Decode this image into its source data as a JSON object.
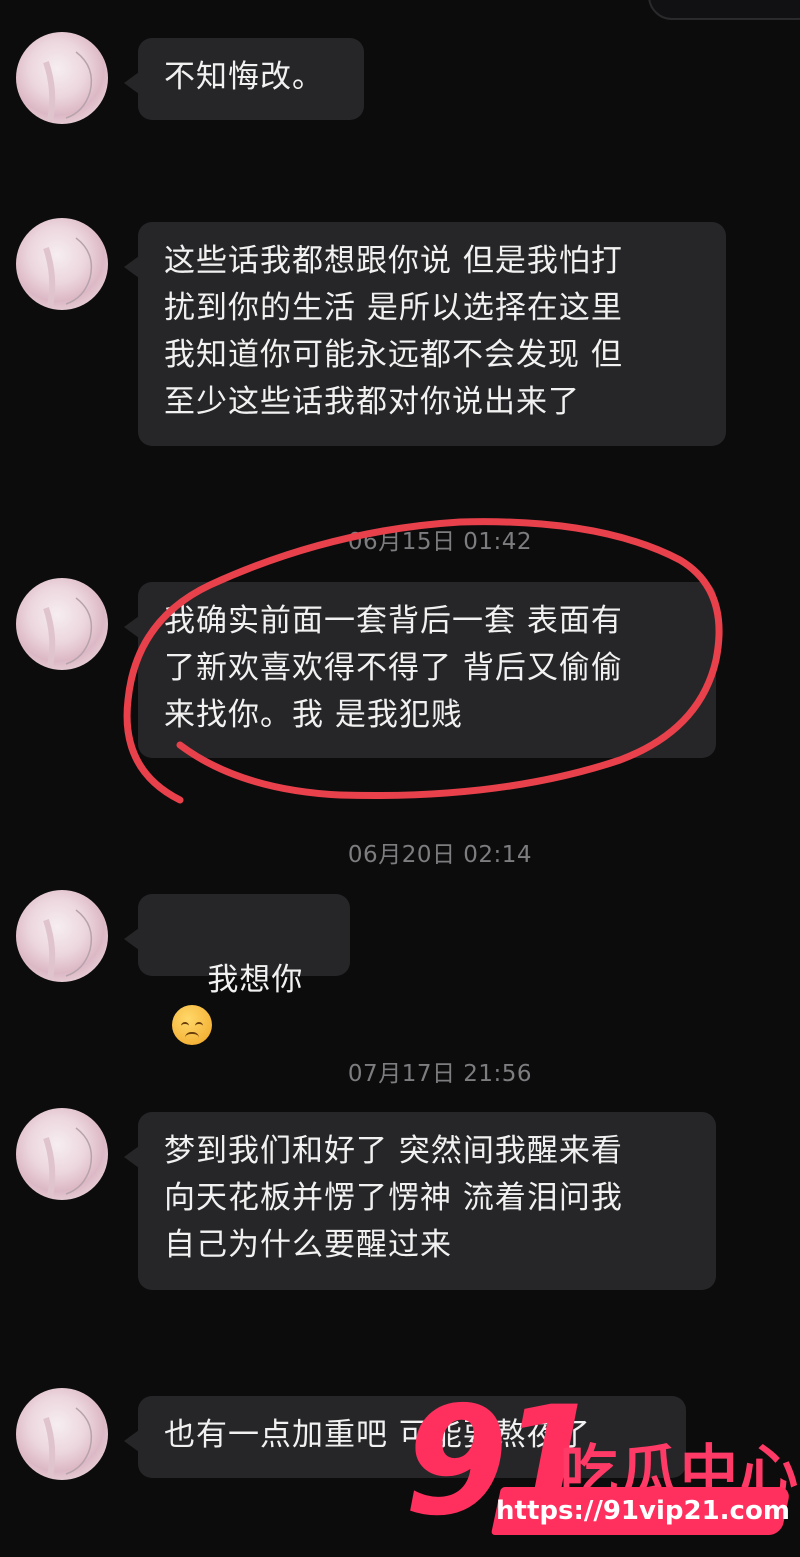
{
  "messages": [
    {
      "text": "不知悔改。"
    },
    {
      "text": "这些话我都想跟你说 但是我怕打\n扰到你的生活 是所以选择在这里\n我知道你可能永远都不会发现 但\n至少这些话我都对你说出来了"
    },
    {
      "text": "我确实前面一套背后一套 表面有\n了新欢喜欢得不得了 背后又偷偷\n来找你。我 是我犯贱"
    },
    {
      "text": "我想你",
      "emoji": "pensive-face"
    },
    {
      "text": "梦到我们和好了 突然间我醒来看\n向天花板并愣了愣神 流着泪问我\n自己为什么要醒过来"
    },
    {
      "text": "也有一点加重吧 可能要熬夜了"
    }
  ],
  "timestamps": [
    "06月15日 01:42",
    "06月20日 02:14",
    "07月17日 21:56"
  ],
  "annotation": {
    "color": "#e8414b",
    "shape": "hand-drawn circle"
  },
  "watermark": {
    "logo": "91",
    "title": "吃瓜中心",
    "url": "https://91vip21.com",
    "color": "#ff2f5e"
  },
  "colors": {
    "background": "#0c0c0d",
    "bubble": "#262628",
    "text": "#f1f1f1",
    "timestamp": "#7d7d80"
  }
}
